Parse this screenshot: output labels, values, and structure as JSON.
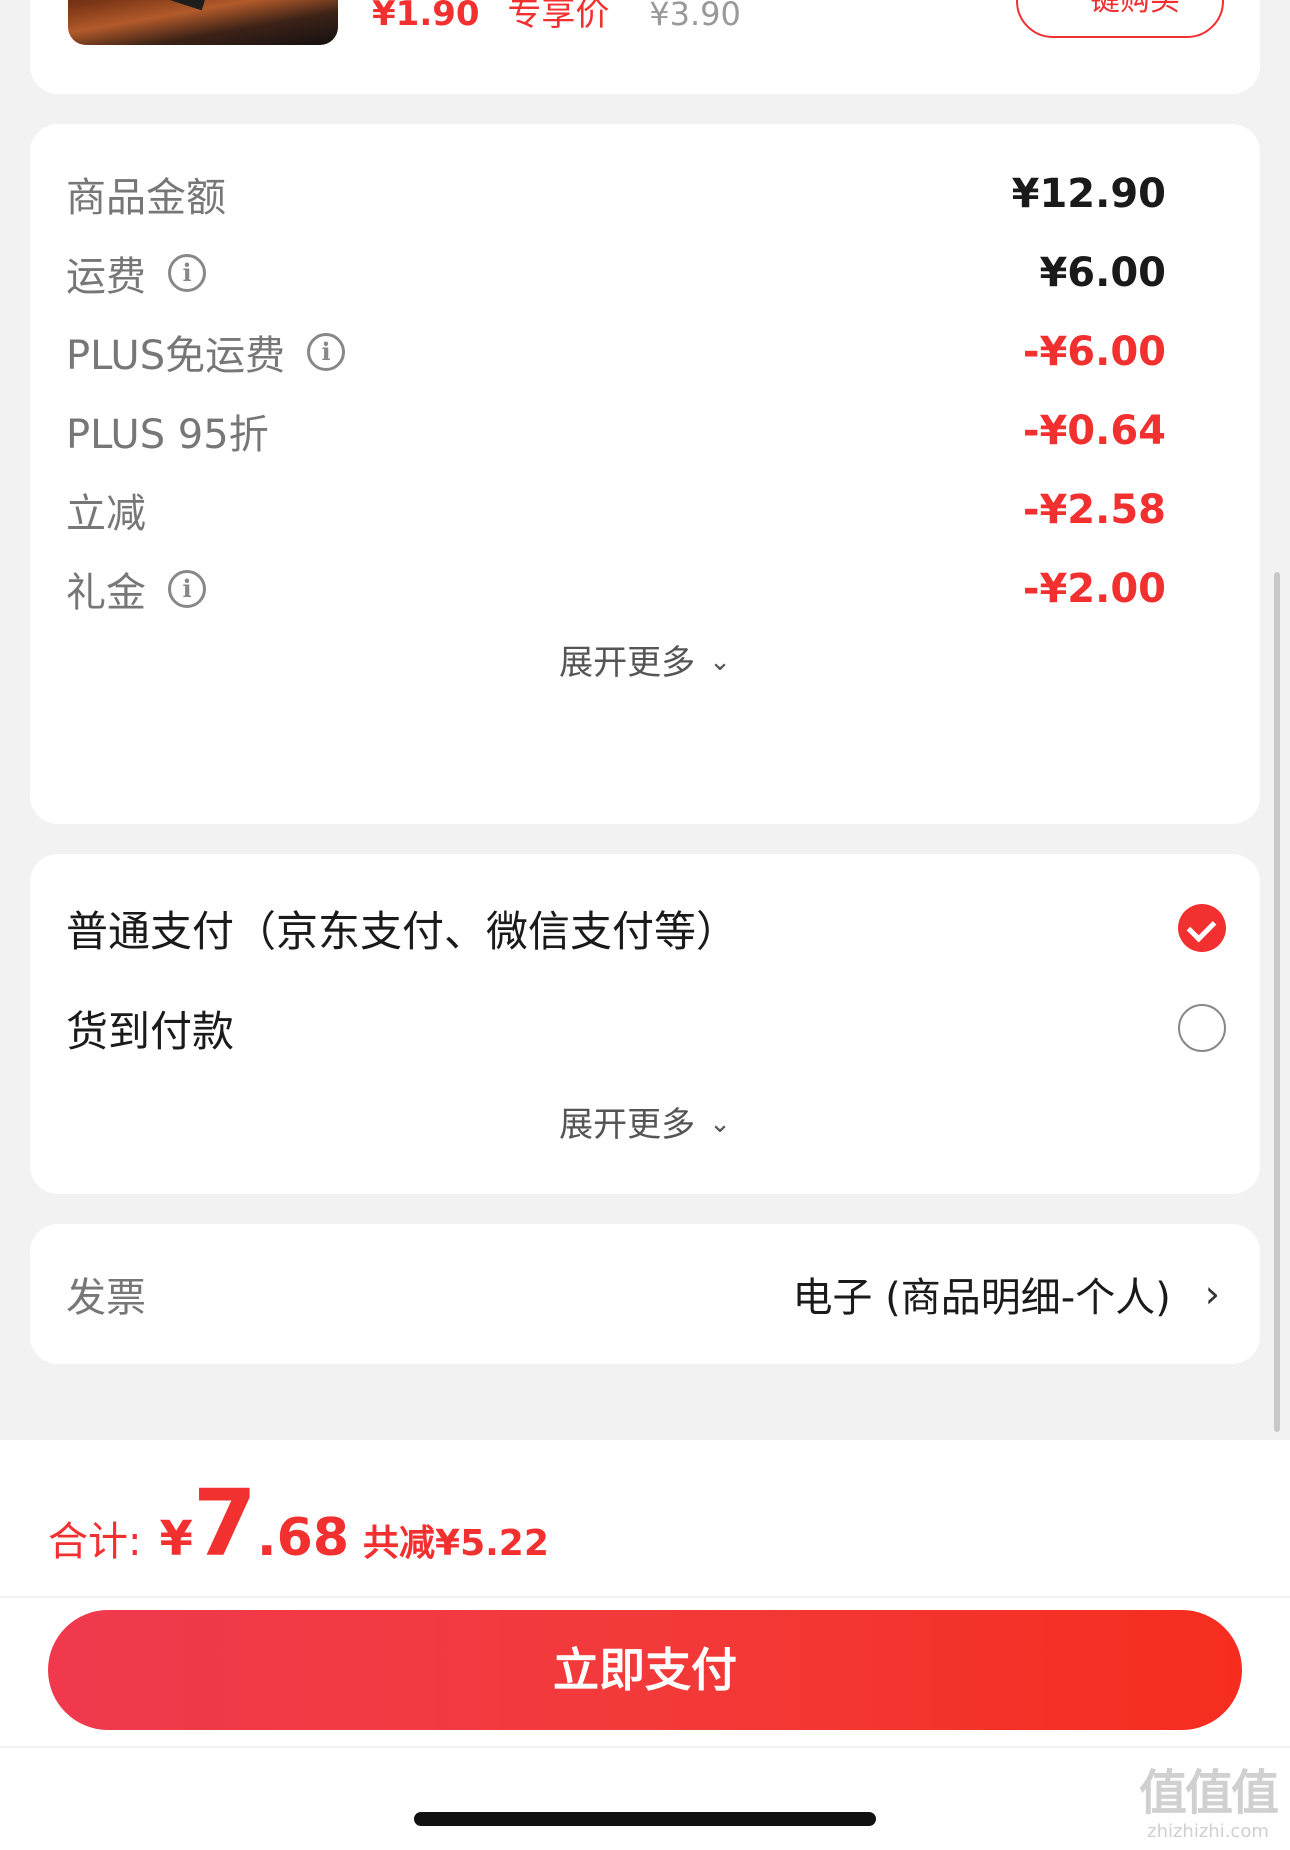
{
  "product": {
    "price": "¥1.90",
    "price_tag": "专享价",
    "original_price": "¥3.90",
    "buy_button": "一键购买"
  },
  "summary": {
    "rows": [
      {
        "label": "商品金额",
        "value": "¥12.90",
        "has_info": false,
        "value_color": "#1a1a1a"
      },
      {
        "label": "运费",
        "value": "¥6.00",
        "has_info": true,
        "value_color": "#1a1a1a"
      },
      {
        "label": "PLUS免运费",
        "value": "-¥6.00",
        "has_info": true,
        "value_color": "#f23030"
      },
      {
        "label": "PLUS 95折",
        "value": "-¥0.64",
        "has_info": false,
        "value_color": "#f23030"
      },
      {
        "label": "立减",
        "value": "-¥2.58",
        "has_info": false,
        "value_color": "#f23030"
      },
      {
        "label": "礼金",
        "value": "-¥2.00",
        "has_info": true,
        "value_color": "#f23030"
      }
    ],
    "info_icon": "info-icon",
    "expand_label": "展开更多"
  },
  "payment": {
    "options": [
      {
        "label": "普通支付（京东支付、微信支付等）",
        "selected": true
      },
      {
        "label": "货到付款",
        "selected": false
      }
    ],
    "expand_label": "展开更多"
  },
  "invoice": {
    "label": "发票",
    "value": "电子 (商品明细-个人)"
  },
  "footer": {
    "total_label": "合计:",
    "total_currency": "¥",
    "total_int": "7",
    "total_dec": ".68",
    "saved_label": "共减¥5.22",
    "pay_button": "立即支付"
  },
  "watermark": {
    "logo": "值值值",
    "url": "zhizhizhi.com"
  },
  "colors": {
    "accent": "#f23030",
    "muted_text": "#777777",
    "background": "#f2f2f2"
  }
}
